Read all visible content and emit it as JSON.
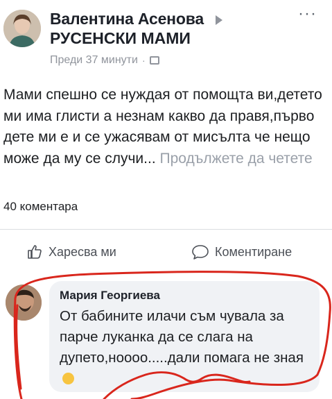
{
  "post": {
    "author": "Валентина Асенова",
    "group": "РУСЕНСКИ МАМИ",
    "time": "Преди 37 минути",
    "separator": "·",
    "more_menu": "···",
    "text": "Мами спешно се нуждая от помощта ви,детето ми има глисти а незнам какво да правя,първо дете ми е и се ужасявам от мисълта че нещо може да му се случи...",
    "continue_reading": "Продължете да четете",
    "comments_count": "40 коментара"
  },
  "actions": {
    "like": "Харесва ми",
    "comment": "Коментиране"
  },
  "comment": {
    "author": "Мария Георгиева",
    "text": "От бабините илачи съм чувала за парче луканка да се слага на дупето,ноооо.....дали помага не зная"
  },
  "colors": {
    "annotation_red": "#d9261c",
    "link_grey": "#9aa0a9"
  },
  "icons": [
    "play-arrow-icon",
    "group-icon",
    "like-thumb-icon",
    "comment-bubble-icon",
    "smile-emoji-icon",
    "more-options-icon"
  ]
}
